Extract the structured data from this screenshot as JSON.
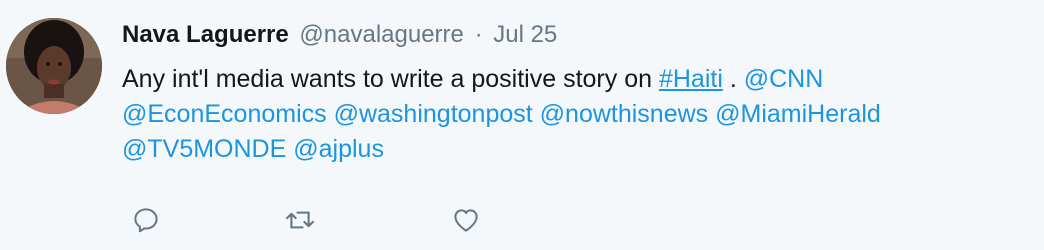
{
  "tweet": {
    "author_name": "Nava Laguerre",
    "handle": "@navalaguerre",
    "separator": "·",
    "date": "Jul 25",
    "text_lead": "Any int'l media wants to write a positive story on ",
    "hashtag": "#Haiti",
    "text_mid": " . ",
    "mentions": {
      "cnn": "@CNN",
      "econ": "@EconEconomics",
      "washpost": "@washingtonpost",
      "nowthis": "@nowthisnews",
      "miamiherald": "@MiamiHerald",
      "tv5monde": "@TV5MONDE",
      "ajplus": "@ajplus"
    }
  },
  "actions": {
    "reply_icon": "reply-icon",
    "retweet_icon": "retweet-icon",
    "like_icon": "heart-icon"
  },
  "colors": {
    "background": "#f5f8fa",
    "link": "#1b95e0",
    "muted": "#657786",
    "text": "#14171a"
  }
}
